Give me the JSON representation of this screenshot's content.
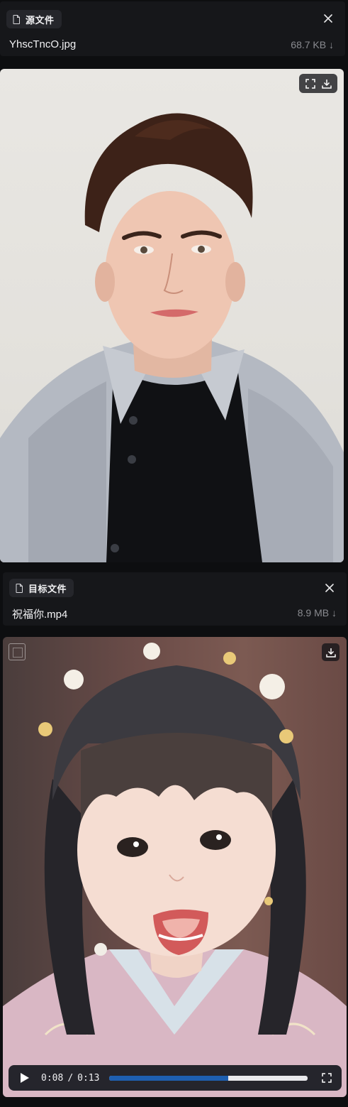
{
  "source": {
    "tag_label": "源文件",
    "file_name": "YhscTncO.jpg",
    "file_size": "68.7 KB ↓"
  },
  "target": {
    "tag_label": "目标文件",
    "file_name": "祝福你.mp4",
    "file_size": "8.9 MB ↓"
  },
  "video": {
    "current_time": "0:08",
    "separator": "/",
    "duration": "0:13",
    "progress": 0.6
  },
  "icons": {
    "tag": "file-icon",
    "close": "close-icon",
    "fullscreen": "fullscreen-icon",
    "download": "download-icon",
    "play": "play-icon",
    "watermark": "watermark-icon"
  },
  "colors": {
    "background": "#0d0e10",
    "card": "#16171a",
    "tag": "#25262b",
    "progress_fill": "#1e5fb0",
    "progress_track": "#e9e9ec"
  }
}
